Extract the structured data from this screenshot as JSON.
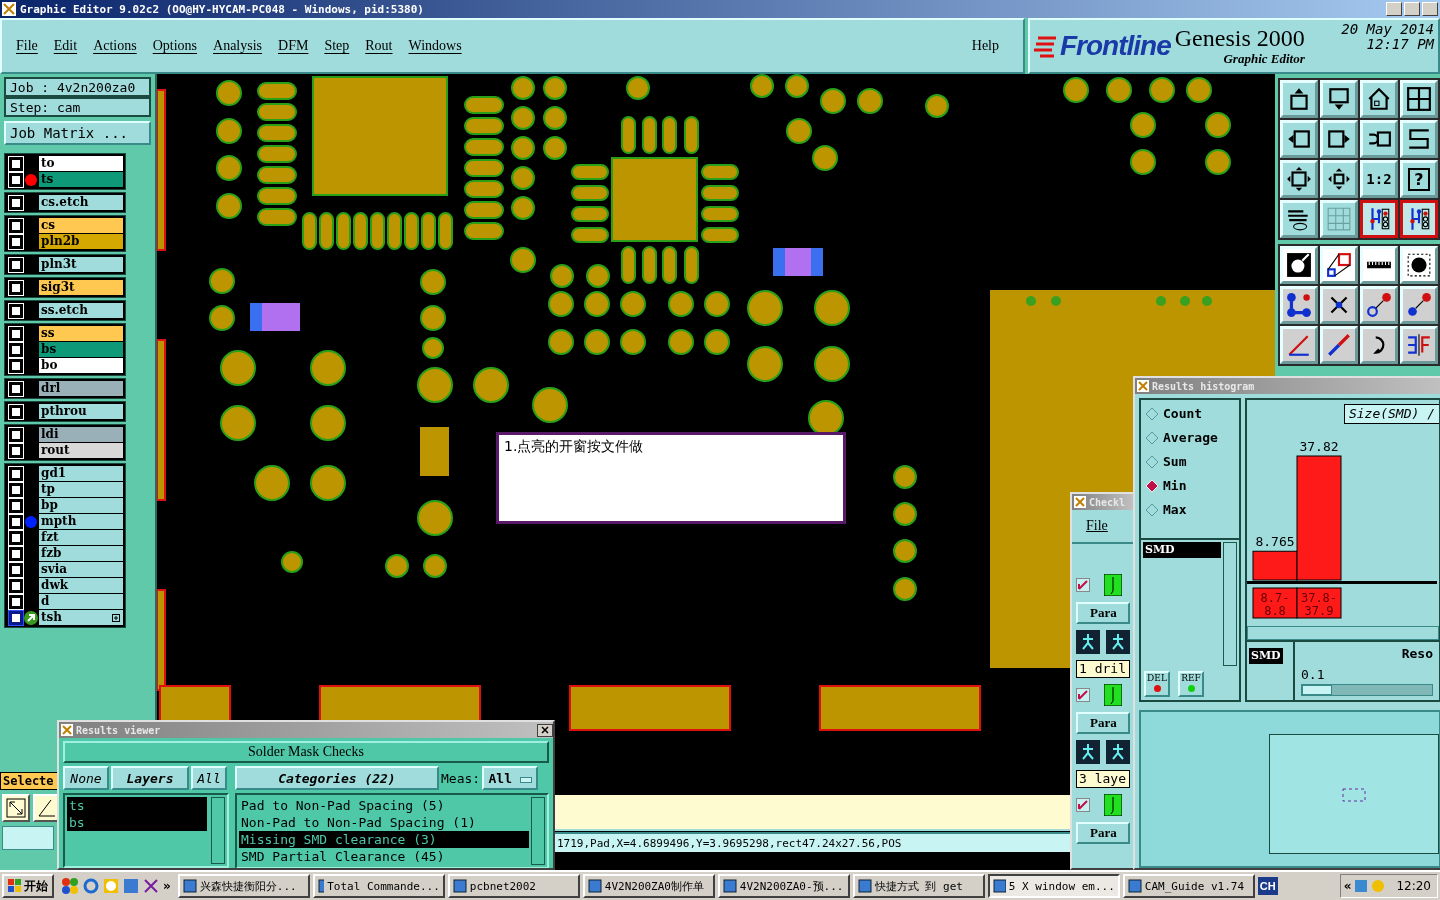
{
  "title_bar": {
    "title": "Graphic Editor 9.02c2 (OO@HY-HYCAM-PC048 - Windows, pid:5380)"
  },
  "menu": {
    "items": [
      "File",
      "Edit",
      "Actions",
      "Options",
      "Analysis",
      "DFM",
      "Step",
      "Rout",
      "Windows"
    ],
    "help": "Help"
  },
  "brand": {
    "logo": "Frontline",
    "product": "Genesis 2000",
    "subtitle": "Graphic Editor",
    "date": "20 May 2014",
    "time": "12:17 PM"
  },
  "job": {
    "job": "Job : 4v2n200za0",
    "step": "Step: cam",
    "matrix_button": "Job Matrix ..."
  },
  "layer_groups": [
    [
      {
        "name": "to",
        "color": "#ffffff",
        "checked": false,
        "current": false
      },
      {
        "name": "ts",
        "color": "#0e9a78",
        "checked": false,
        "current": false,
        "marker": {
          "color": "#ff0000"
        }
      }
    ],
    [
      {
        "name": "cs.etch",
        "color": "#a0dcdc",
        "checked": false,
        "current": false
      }
    ],
    [
      {
        "name": "cs",
        "color": "#ffc850",
        "checked": false,
        "current": false
      },
      {
        "name": "pln2b",
        "color": "#d4a800",
        "checked": false,
        "current": false
      }
    ],
    [
      {
        "name": "pln3t",
        "color": "#a0dcdc",
        "checked": false,
        "current": false
      }
    ],
    [
      {
        "name": "sig3t",
        "color": "#ffc850",
        "checked": false,
        "current": false
      }
    ],
    [
      {
        "name": "ss.etch",
        "color": "#a0dcdc",
        "checked": false,
        "current": false
      }
    ],
    [
      {
        "name": "ss",
        "color": "#ffc850",
        "checked": false,
        "current": false
      },
      {
        "name": "bs",
        "color": "#0e9a78",
        "checked": false,
        "current": false
      },
      {
        "name": "bo",
        "color": "#ffffff",
        "checked": false,
        "current": false
      }
    ],
    [
      {
        "name": "drl",
        "color": "#9ab0b8",
        "checked": false,
        "current": false
      }
    ],
    [
      {
        "name": "pthrou",
        "color": "#a0dcdc",
        "checked": false,
        "current": false
      }
    ],
    [
      {
        "name": "ldi",
        "color": "#9ab0b8",
        "checked": false,
        "current": false
      },
      {
        "name": "rout",
        "color": "#d8d8d8",
        "checked": false,
        "current": false
      }
    ],
    [
      {
        "name": "gd1",
        "color": "#a0dcdc",
        "checked": false,
        "current": false
      },
      {
        "name": "tp",
        "color": "#a0dcdc",
        "checked": false,
        "current": false
      },
      {
        "name": "bp",
        "color": "#a0dcdc",
        "checked": false,
        "current": false
      },
      {
        "name": "mpth",
        "color": "#a0dcdc",
        "checked": false,
        "current": false,
        "marker": {
          "color": "#0022ff"
        }
      },
      {
        "name": "fzt",
        "color": "#a0dcdc",
        "checked": false,
        "current": false
      },
      {
        "name": "fzb",
        "color": "#a0dcdc",
        "checked": false,
        "current": false
      },
      {
        "name": "svia",
        "color": "#a0dcdc",
        "checked": false,
        "current": false
      },
      {
        "name": "dwk",
        "color": "#a0dcdc",
        "checked": false,
        "current": false
      },
      {
        "name": "d",
        "color": "#a0dcdc",
        "checked": false,
        "current": false
      },
      {
        "name": "tsh",
        "color": "#a0dcdc",
        "checked": false,
        "current": true
      }
    ]
  ],
  "left_footer": {
    "selected_label": "Selecte"
  },
  "canvas": {
    "note": "1.点亮的开窗按文件做",
    "status": "1719,Pad,X=4.6899496,Y=3.9695298,rect47.24x27.56,POS"
  },
  "toolbox": {
    "top": [
      {
        "kind": "push-up",
        "highlighted": false
      },
      {
        "kind": "push-down",
        "highlighted": false
      },
      {
        "kind": "home",
        "highlighted": false
      },
      {
        "kind": "panes",
        "highlighted": false
      },
      {
        "kind": "left-box",
        "highlighted": false
      },
      {
        "kind": "right-box",
        "highlighted": false
      },
      {
        "kind": "undo-box",
        "highlighted": false
      },
      {
        "kind": "s-curve",
        "highlighted": false
      },
      {
        "kind": "fit",
        "highlighted": false
      },
      {
        "kind": "center",
        "highlighted": false
      },
      {
        "kind": "text",
        "label": "1:2",
        "highlighted": false
      },
      {
        "kind": "text-box",
        "label": "?",
        "highlighted": false
      },
      {
        "kind": "tools",
        "highlighted": false
      },
      {
        "kind": "grid",
        "highlighted": false
      },
      {
        "kind": "net",
        "highlighted": true
      },
      {
        "kind": "net",
        "highlighted": true
      }
    ],
    "bottom": [
      {
        "kind": "pad-frame"
      },
      {
        "kind": "shapes"
      },
      {
        "kind": "ruler"
      },
      {
        "kind": "dot-frame"
      },
      {
        "kind": "nodes"
      },
      {
        "kind": "cross"
      },
      {
        "kind": "link-hollow"
      },
      {
        "kind": "link-solid"
      },
      {
        "kind": "angle"
      },
      {
        "kind": "line"
      },
      {
        "kind": "rotate"
      },
      {
        "kind": "mirror"
      }
    ]
  },
  "results_viewer": {
    "title": "Results viewer",
    "header": "Solder Mask Checks",
    "none_button": "None",
    "layers_button": "Layers",
    "all_button": "All",
    "layers": [
      {
        "name": "ts",
        "selected": true
      },
      {
        "name": "bs",
        "selected": true
      }
    ],
    "categories_button": "Categories (22)",
    "meas_label": "Meas:",
    "meas_value": "All",
    "categories": [
      {
        "name": "Pad to Non-Pad Spacing (5)",
        "selected": false
      },
      {
        "name": "Non-Pad to Non-Pad Spacing (1)",
        "selected": false
      },
      {
        "name": "Missing SMD clearance (3)",
        "selected": true
      },
      {
        "name": "SMD Partial Clearance (45)",
        "selected": false
      }
    ]
  },
  "checklist": {
    "title": "Checkl",
    "menu": "File",
    "rows": [
      {
        "checked": true,
        "param": "Para",
        "field": "1 dril"
      },
      {
        "checked": true,
        "param": "Para",
        "field": "3 laye"
      },
      {
        "checked": true,
        "param": "Para"
      }
    ]
  },
  "histogram": {
    "title": "Results histogram",
    "modes": [
      {
        "label": "Count",
        "selected": false
      },
      {
        "label": "Average",
        "selected": false
      },
      {
        "label": "Sum",
        "selected": false
      },
      {
        "label": "Min",
        "selected": true
      },
      {
        "label": "Max",
        "selected": false
      }
    ],
    "list": [
      {
        "name": "SMD",
        "selected": true
      }
    ],
    "del_button": "DEL",
    "ref_button": "REF",
    "chart_data": {
      "type": "bar",
      "title": "Size(SMD) / ",
      "categories": [
        "8.7-8.8",
        "37.8-37.9"
      ],
      "values": [
        8.765,
        37.82
      ],
      "data_labels": true
    },
    "lower_list": [
      {
        "name": "SMD",
        "selected": true
      }
    ],
    "resolution_label": "Reso",
    "resolution_value": "0.1",
    "resolution_slider": {
      "level": 0
    }
  },
  "taskbar": {
    "start": "开始",
    "chevron": "»",
    "tasks": [
      {
        "label": "兴森快捷衡阳分...",
        "selected": false
      },
      {
        "label": "Total Commande...",
        "selected": false
      },
      {
        "label": "pcbnet2002",
        "selected": false
      },
      {
        "label": "4V2N200ZA0制作单",
        "selected": false
      },
      {
        "label": "4V2N200ZA0-预...",
        "selected": false
      },
      {
        "label": "快捷方式 到 get",
        "selected": false
      },
      {
        "label": "5 X window em...",
        "selected": true
      },
      {
        "label": "CAM_Guide v1.74",
        "selected": false
      }
    ],
    "language": "CH",
    "tray_chevron": "«",
    "clock": "12:20"
  }
}
